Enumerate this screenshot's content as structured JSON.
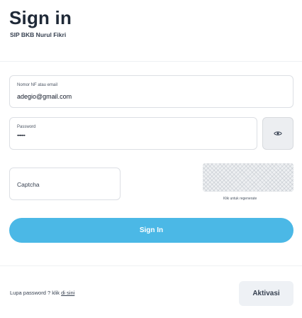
{
  "header": {
    "title": "Sign in",
    "subtitle": "SIP BKB Nurul Fikri"
  },
  "form": {
    "email": {
      "label": "Nomor NF atau email",
      "value": "adegio@gmail.com"
    },
    "password": {
      "label": "Password",
      "value": "•••••••"
    },
    "captcha": {
      "label": "Captcha",
      "hint": "Klik untuk regenerate"
    },
    "signin_label": "Sign In"
  },
  "footer": {
    "forgot_prefix": "Lupa password ? klik ",
    "forgot_link": "di sini",
    "aktivasi_label": "Aktivasi"
  },
  "icons": {
    "toggle_password": "eye-icon"
  },
  "colors": {
    "primary": "#4bb8e6",
    "secondary_button": "#eef1f5"
  }
}
